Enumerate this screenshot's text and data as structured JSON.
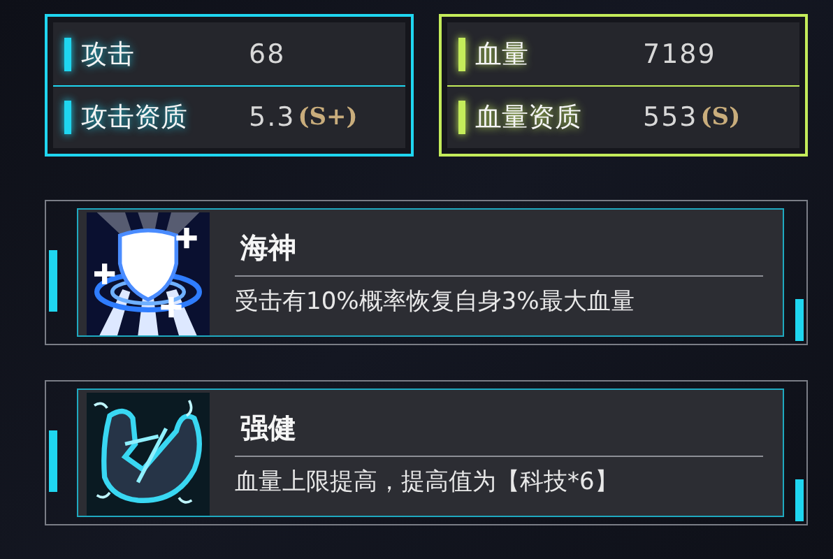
{
  "stat_panels": [
    {
      "color": "#1fd6f0",
      "rows": [
        {
          "label": "攻击",
          "value": "68"
        },
        {
          "label": "攻击资质",
          "value": "5.3",
          "grade": "(S+)"
        }
      ]
    },
    {
      "color": "#c4ec5a",
      "rows": [
        {
          "label": "血量",
          "value": "7189"
        },
        {
          "label": "血量资质",
          "value": "553",
          "grade": "(S)"
        }
      ]
    }
  ],
  "skills": [
    {
      "kind": "shield",
      "name": "海神",
      "description": "受击有10%概率恢复自身3%最大血量"
    },
    {
      "kind": "arm",
      "name": "强健",
      "description": "血量上限提高，提高值为【科技*6】"
    }
  ]
}
